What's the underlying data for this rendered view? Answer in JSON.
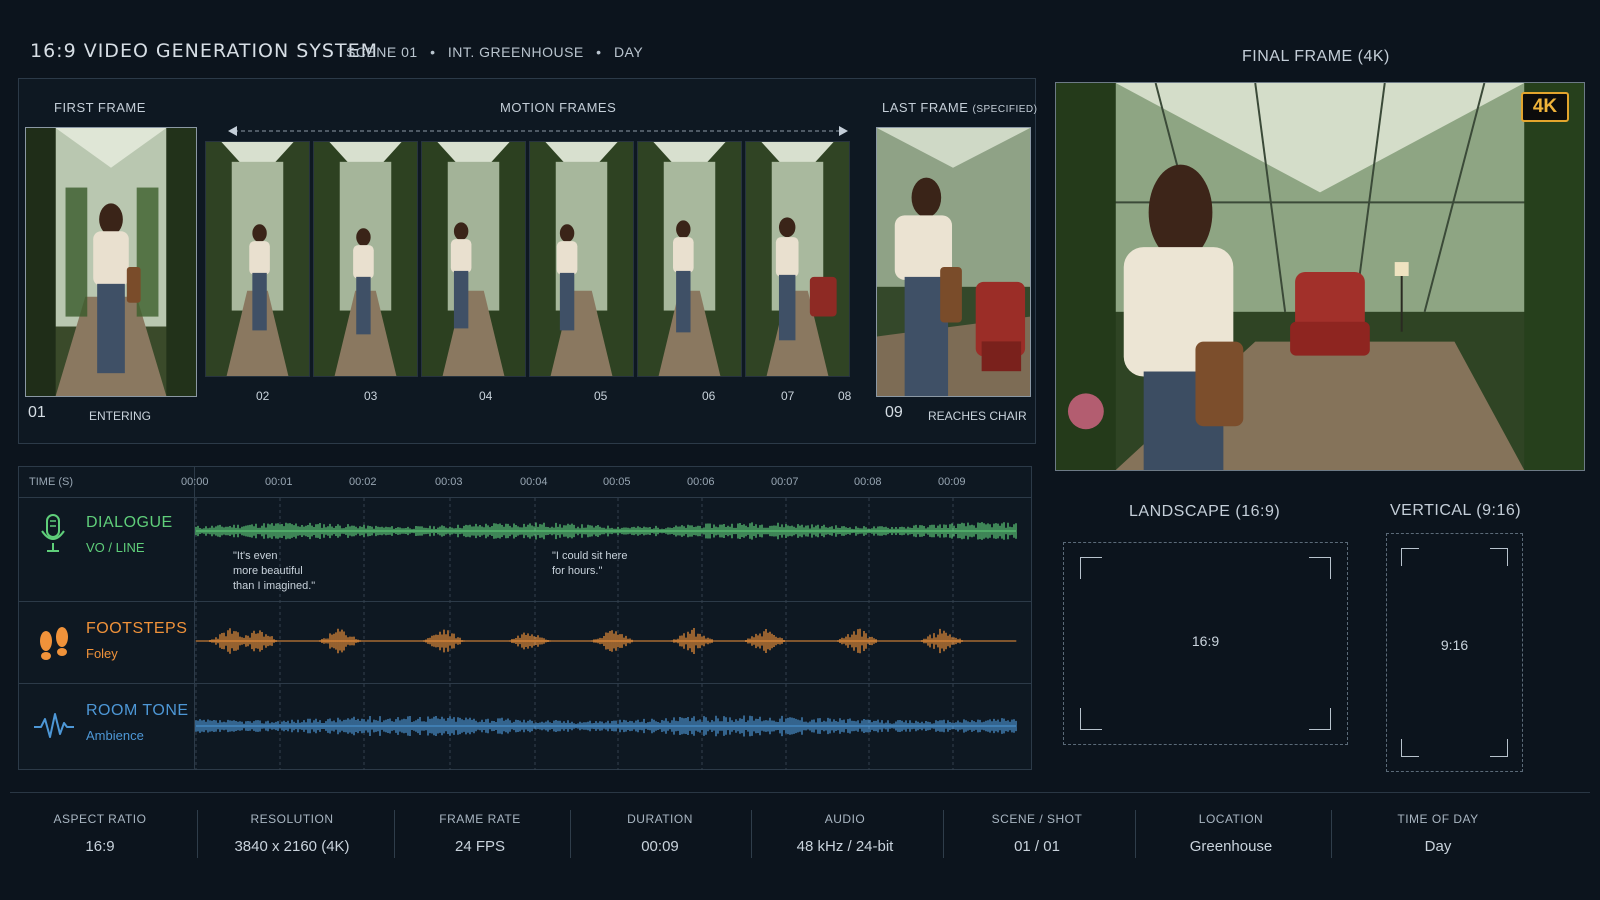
{
  "header": {
    "title": "16:9 VIDEO GENERATION SYSTEM",
    "scene": "SCENE 01",
    "location": "INT. GREENHOUSE",
    "time": "DAY",
    "sep": "•"
  },
  "frames": {
    "first_label": "FIRST FRAME",
    "motion_label": "MOTION FRAMES",
    "last_label": "LAST FRAME",
    "last_label_note": "(SPECIFIED)",
    "first_num": "01",
    "first_caption": "ENTERING",
    "last_num": "09",
    "last_caption": "REACHES CHAIR",
    "motion_numbers": [
      "02",
      "03",
      "04",
      "05",
      "06",
      "07",
      "08"
    ]
  },
  "final": {
    "label": "FINAL FRAME (4K)",
    "badge": "4K"
  },
  "timeline": {
    "time_label": "TIME (S)",
    "ticks": [
      "00:00",
      "00:01",
      "00:02",
      "00:03",
      "00:04",
      "00:05",
      "00:06",
      "00:07",
      "00:08",
      "00:09"
    ],
    "tracks": [
      {
        "name": "DIALOGUE",
        "sub": "VO / LINE",
        "color": "#5fce7a",
        "icon": "microphone-icon"
      },
      {
        "name": "FOOTSTEPS",
        "sub": "Foley",
        "color": "#f0923a",
        "icon": "footprints-icon"
      },
      {
        "name": "ROOM TONE",
        "sub": "Ambience",
        "color": "#4d97d6",
        "icon": "waveform-icon"
      }
    ],
    "quote1": [
      "\"It's even",
      "more beautiful",
      "than I imagined.\""
    ],
    "quote2": [
      "\"I could sit here",
      "for hours.\""
    ]
  },
  "aspect": {
    "landscape_label": "LANDSCAPE (16:9)",
    "landscape_ratio": "16:9",
    "vertical_label": "VERTICAL (9:16)",
    "vertical_ratio": "9:16"
  },
  "meta": [
    {
      "label": "ASPECT RATIO",
      "value": "16:9"
    },
    {
      "label": "RESOLUTION",
      "value": "3840 x 2160 (4K)"
    },
    {
      "label": "FRAME RATE",
      "value": "24 FPS"
    },
    {
      "label": "DURATION",
      "value": "00:09"
    },
    {
      "label": "AUDIO",
      "value": "48 kHz / 24-bit"
    },
    {
      "label": "SCENE / SHOT",
      "value": "01 / 01"
    },
    {
      "label": "LOCATION",
      "value": "Greenhouse"
    },
    {
      "label": "TIME OF DAY",
      "value": "Day"
    }
  ]
}
